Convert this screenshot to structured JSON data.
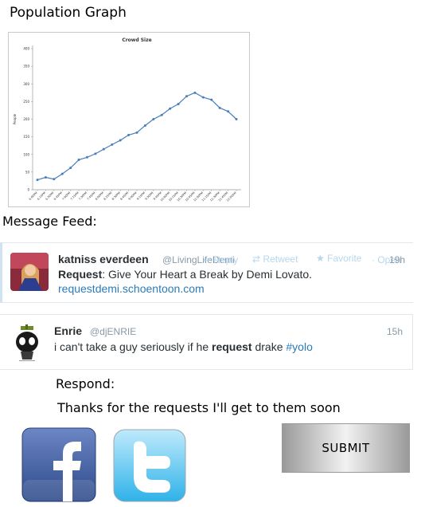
{
  "headings": {
    "population_graph": "Population Graph",
    "message_feed": "Message Feed:",
    "respond": "Respond:"
  },
  "chart_data": {
    "type": "line",
    "title": "Crowd Size",
    "ylabel": "People",
    "xlabel": "",
    "ylim": [
      0,
      400
    ],
    "yticks": [
      0,
      50,
      100,
      150,
      200,
      250,
      300,
      350,
      400
    ],
    "categories": [
      "6:00PM",
      "6:15PM",
      "6:30PM",
      "6:45PM",
      "7:00PM",
      "7:15PM",
      "7:30PM",
      "7:45PM",
      "8:00PM",
      "8:15PM",
      "8:30PM",
      "8:45PM",
      "9:00PM",
      "9:15PM",
      "9:30PM",
      "9:45PM",
      "10:00PM",
      "10:15PM",
      "10:30PM",
      "10:45PM",
      "11:00PM",
      "11:15PM",
      "11:30PM",
      "11:45PM",
      "12:00AM"
    ],
    "values": [
      28,
      35,
      30,
      45,
      62,
      85,
      92,
      102,
      115,
      128,
      140,
      155,
      162,
      182,
      200,
      212,
      230,
      243,
      265,
      275,
      262,
      255,
      232,
      222,
      200
    ],
    "grid": false,
    "color": "#4a7ebb"
  },
  "tweets": [
    {
      "name": "katniss everdeen",
      "handle": "@LivingLifeDemi",
      "time": "19h",
      "text_bold": "Request",
      "text_rest": ": Give Your Heart a Break by Demi Lovato.",
      "link": "requestdemi.schoentoon.com",
      "actions": {
        "reply": "Reply",
        "retweet": "Retweet",
        "favorite": "Favorite",
        "more": "Open"
      }
    },
    {
      "name": "Enrie",
      "handle": "@djENRIE",
      "time": "15h",
      "text_before": "i can't take a guy seriously if he ",
      "text_bold": "request",
      "text_after": " drake ",
      "hashtag": "#yolo"
    }
  ],
  "reply_text": "Thanks for the requests I'll get to them soon",
  "submit_label": "SUBMIT",
  "icons": {
    "facebook": "facebook-icon",
    "twitter": "twitter-icon"
  },
  "colors": {
    "facebook": "#3b5998",
    "twitter": "#55acee",
    "link": "#2b7bb9"
  }
}
